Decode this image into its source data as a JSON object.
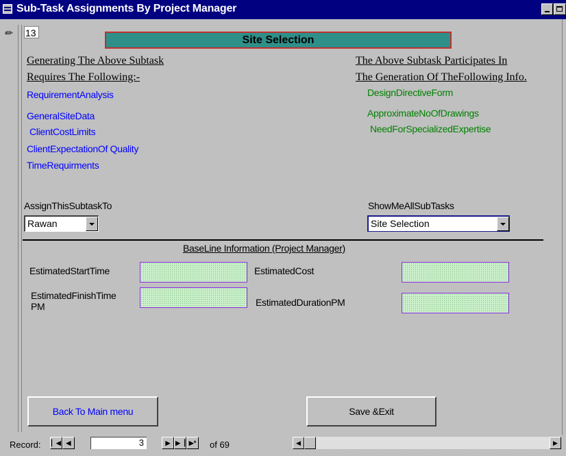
{
  "window": {
    "title": "Sub-Task Assignments By Project Manager"
  },
  "record_id": "13",
  "banner": "Site Selection",
  "left_section": {
    "header_line1": "Generating The Above Subtask ",
    "header_line2": "Requires The Following:-",
    "items": [
      "RequirementAnalysis",
      "GeneralSiteData",
      "ClientCostLimits",
      "ClientExpectationOf Quality",
      "TimeRequirments"
    ]
  },
  "right_section": {
    "header_line1": "The Above Subtask Participates In ",
    "header_line2": "The Generation Of TheFollowing Info.",
    "items": [
      "DesignDirectiveForm",
      "ApproximateNoOfDrawings",
      "NeedForSpecializedExpertise"
    ]
  },
  "assign": {
    "label": "AssignThisSubtaskTo",
    "value": "Rawan"
  },
  "show": {
    "label": "ShowMeAllSubTasks",
    "value": "Site Selection"
  },
  "baseline": {
    "title": "BaseLine Information (Project Manager)",
    "est_start_label": "EstimatedStartTime",
    "est_finish_label_1": "EstimatedFinishTime",
    "est_finish_label_2": "PM",
    "est_cost_label": "EstimatedCost",
    "est_duration_label": "EstimatedDurationPM"
  },
  "buttons": {
    "back": "Back To Main menu",
    "save": "Save &Exit"
  },
  "nav": {
    "label": "Record:",
    "current": "3",
    "of": "of  69"
  },
  "colors": {
    "title_bar": "#000080",
    "banner": "#2f8f89",
    "link_blue": "#0000ff",
    "link_green": "#008000"
  }
}
